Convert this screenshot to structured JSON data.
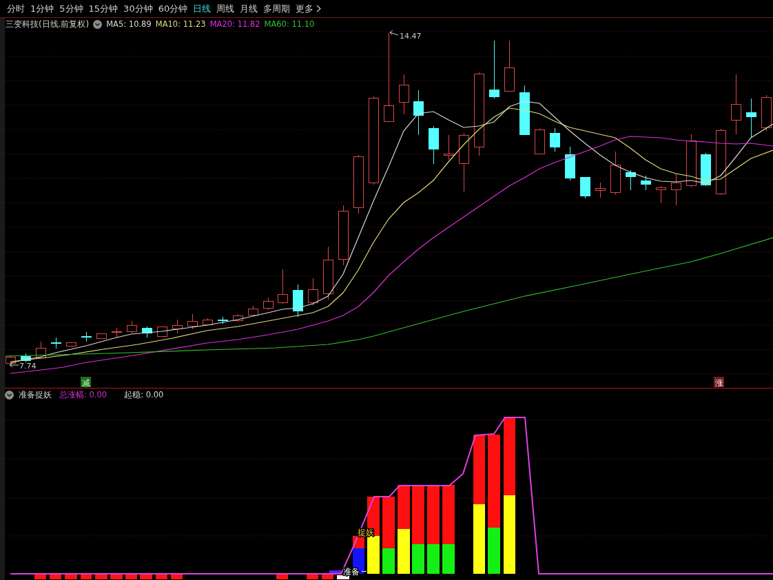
{
  "period_tabs": [
    {
      "label": "分时",
      "selected": false
    },
    {
      "label": "1分钟",
      "selected": false
    },
    {
      "label": "5分钟",
      "selected": false
    },
    {
      "label": "15分钟",
      "selected": false
    },
    {
      "label": "30分钟",
      "selected": false
    },
    {
      "label": "60分钟",
      "selected": false
    },
    {
      "label": "日线",
      "selected": true
    },
    {
      "label": "周线",
      "selected": false
    },
    {
      "label": "月线",
      "selected": false
    },
    {
      "label": "多周期",
      "selected": false
    }
  ],
  "more_menu": {
    "label": "更多"
  },
  "main_chart": {
    "title": "三变科技(日线.前复权)",
    "moving_averages": [
      {
        "text": "MA5: 10.89",
        "color": "#d8d8d8"
      },
      {
        "text": "MA10: 11.23",
        "color": "#e0dc78"
      },
      {
        "text": "MA20: 11.82",
        "color": "#e030e0"
      },
      {
        "text": "MA60: 11.10",
        "color": "#30c030"
      }
    ],
    "high_label": "14.47",
    "low_label": "7.74",
    "signals": [
      {
        "text": "减",
        "kind": "reduce"
      },
      {
        "text": "涨",
        "kind": "rise"
      }
    ]
  },
  "indicator_panel": {
    "title": "准备捉妖",
    "readouts": [
      {
        "text": "总涨幅: 0.00",
        "color": "#d030d0"
      },
      {
        "text": "起稳: 0.00",
        "color": "#d8d8d8"
      }
    ],
    "labels": [
      {
        "text": "捉妖",
        "kind": "catch"
      },
      {
        "text": "准备",
        "kind": "ready"
      }
    ]
  }
}
